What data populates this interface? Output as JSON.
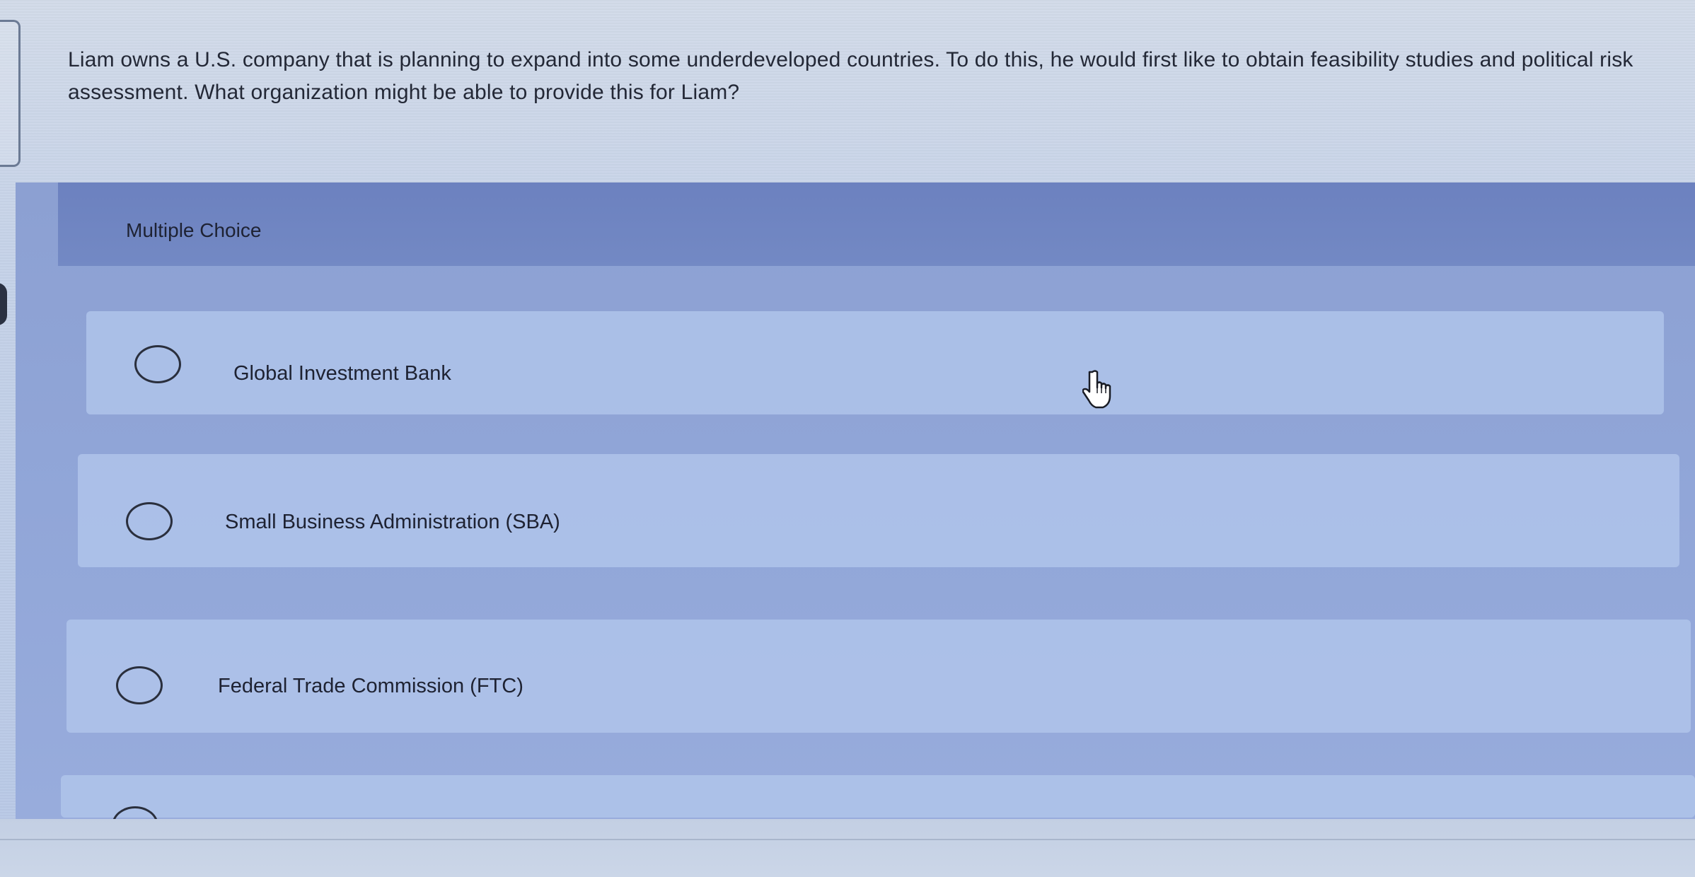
{
  "question": {
    "text": "Liam owns a U.S. company that is planning to expand into some underdeveloped countries. To do this, he would first like to obtain feasibility studies and political risk assessment. What organization might be able to provide this for Liam?"
  },
  "multiple_choice": {
    "header_label": "Multiple Choice",
    "options": [
      {
        "label": "Global Investment Bank",
        "selected": false
      },
      {
        "label": "Small Business Administration (SBA)",
        "selected": false
      },
      {
        "label": "Federal Trade Commission (FTC)",
        "selected": false
      },
      {
        "label": "",
        "selected": false
      }
    ]
  },
  "cursor": {
    "icon": "hand-pointer-icon"
  }
}
